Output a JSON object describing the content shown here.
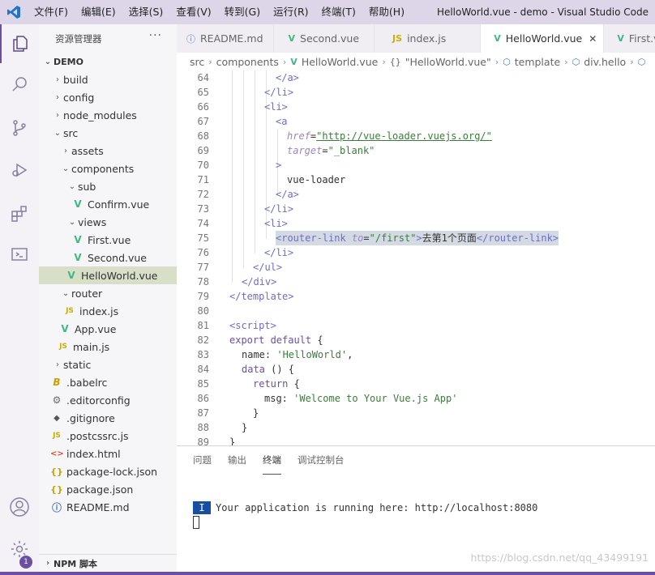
{
  "titlebar": {
    "menu": [
      "文件(F)",
      "编辑(E)",
      "选择(S)",
      "查看(V)",
      "转到(G)",
      "运行(R)",
      "终端(T)",
      "帮助(H)"
    ],
    "title": "HelloWorld.vue - demo - Visual Studio Code"
  },
  "activity": {
    "badge": "1"
  },
  "sidebar": {
    "title": "资源管理器",
    "more": "···",
    "root": "DEMO",
    "items": [
      {
        "label": "build"
      },
      {
        "label": "config"
      },
      {
        "label": "node_modules"
      },
      {
        "label": "src"
      },
      {
        "label": "assets"
      },
      {
        "label": "components"
      },
      {
        "label": "sub"
      },
      {
        "label": "Confirm.vue"
      },
      {
        "label": "views"
      },
      {
        "label": "First.vue"
      },
      {
        "label": "Second.vue"
      },
      {
        "label": "HelloWorld.vue"
      },
      {
        "label": "router"
      },
      {
        "label": "index.js"
      },
      {
        "label": "App.vue"
      },
      {
        "label": "main.js"
      },
      {
        "label": "static"
      },
      {
        "label": ".babelrc"
      },
      {
        "label": ".editorconfig"
      },
      {
        "label": ".gitignore"
      },
      {
        "label": ".postcssrc.js"
      },
      {
        "label": "index.html"
      },
      {
        "label": "package-lock.json"
      },
      {
        "label": "package.json"
      },
      {
        "label": "README.md"
      }
    ],
    "npm": "NPM 脚本"
  },
  "tabs": [
    {
      "label": "README.md",
      "icon": "ⓘ"
    },
    {
      "label": "Second.vue",
      "icon": "V"
    },
    {
      "label": "index.js",
      "icon": "JS"
    },
    {
      "label": "HelloWorld.vue",
      "icon": "V",
      "close": "✕"
    },
    {
      "label": "First.vu",
      "icon": "V"
    }
  ],
  "breadcrumb": [
    "src",
    "components",
    "HelloWorld.vue",
    "\"HelloWorld.vue\"",
    "template",
    "div.hello"
  ],
  "editor": {
    "lines": [
      {
        "n": "64"
      },
      {
        "n": "65"
      },
      {
        "n": "66"
      },
      {
        "n": "67"
      },
      {
        "n": "68"
      },
      {
        "n": "69"
      },
      {
        "n": "70"
      },
      {
        "n": "71"
      },
      {
        "n": "72"
      },
      {
        "n": "73"
      },
      {
        "n": "74"
      },
      {
        "n": "75"
      },
      {
        "n": "76"
      },
      {
        "n": "77"
      },
      {
        "n": "78"
      },
      {
        "n": "79"
      },
      {
        "n": "80"
      },
      {
        "n": "81"
      },
      {
        "n": "82"
      },
      {
        "n": "83"
      },
      {
        "n": "84"
      },
      {
        "n": "85"
      },
      {
        "n": "86"
      },
      {
        "n": "87"
      },
      {
        "n": "88"
      },
      {
        "n": "89"
      }
    ],
    "text": {
      "close_a": "</a>",
      "close_li": "</li>",
      "open_li": "<li>",
      "open_a": "<a",
      "href_attr": "href",
      "href_val": "\"http://vue-loader.vuejs.org/\"",
      "target_attr": "target",
      "target_val": "\"_blank\"",
      "gt": ">",
      "vue_loader": "vue-loader",
      "rl_open": "<router-link",
      "to_attr": "to",
      "to_val": "\"/first\"",
      "rl_gt": ">",
      "rl_text": "去第1个页面",
      "rl_close": "</router-link>",
      "close_ul": "</ul>",
      "close_div": "</div>",
      "close_template": "</template>",
      "open_script": "<script>",
      "export_kw": "export default",
      "brace_open": " {",
      "name_key": "name: ",
      "name_val": "'HelloWorld'",
      "comma": ",",
      "data_kw": "data",
      "data_rest": " () {",
      "return_kw": "return",
      "return_rest": " {",
      "msg_key": "msg: ",
      "msg_val": "'Welcome to Your Vue.js App'",
      "close_brace": "}",
      "close_brace2": "}",
      "close_brace3": "}",
      "eq": "="
    }
  },
  "panel": {
    "tabs": [
      "问题",
      "输出",
      "终端",
      "调试控制台"
    ],
    "terminal_badge": "I",
    "terminal_text": "Your application is running here: http://localhost:8080",
    "watermark": "https://blog.csdn.net/qq_43499191"
  }
}
